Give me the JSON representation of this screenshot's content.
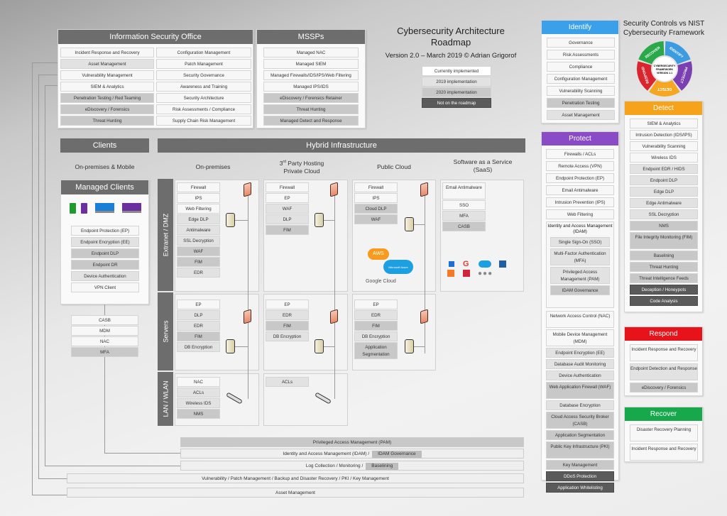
{
  "title": {
    "line1": "Cybersecurity Architecture",
    "line2": "Roadmap",
    "version": "Version 2.0 – March 2019 ©  Adrian Grigorof"
  },
  "legend": [
    {
      "label": "Currently implemented",
      "status": "current"
    },
    {
      "label": "2019 implementation",
      "status": "2019"
    },
    {
      "label": "2020 implementation",
      "status": "2020"
    },
    {
      "label": "Not on the roadmap",
      "status": "none"
    }
  ],
  "iso": {
    "title": "Information Security Office",
    "left": [
      {
        "label": "Incident Response and Recovery",
        "s": 0
      },
      {
        "label": "Asset Management",
        "s": 1
      },
      {
        "label": "Vulnerability Management",
        "s": 0
      },
      {
        "label": "SIEM & Analytics",
        "s": 0
      },
      {
        "label": "Penetration Testing / Red Teaming",
        "s": 2
      },
      {
        "label": "eDiscovery / Forensics",
        "s": 2
      },
      {
        "label": "Threat Hunting",
        "s": 2
      }
    ],
    "right": [
      {
        "label": "Configuration Management",
        "s": 0
      },
      {
        "label": "Patch Management",
        "s": 0
      },
      {
        "label": "Security Governance",
        "s": 0
      },
      {
        "label": "Awareness and Training",
        "s": 0
      },
      {
        "label": "Security Architecture",
        "s": 0
      },
      {
        "label": "Risk Assessments / Compliance",
        "s": 0
      },
      {
        "label": "Supply Chain Risk Management",
        "s": 0
      }
    ]
  },
  "mssp": {
    "title": "MSSPs",
    "items": [
      {
        "label": "Managed NAC",
        "s": 0
      },
      {
        "label": "Managed SIEM",
        "s": 0
      },
      {
        "label": "Managed Firewalls/IDS/IPS/Web Filtering",
        "s": 0
      },
      {
        "label": "Managed IPS/IDS",
        "s": 0
      },
      {
        "label": "eDiscovery / Forensics Retainer",
        "s": 2
      },
      {
        "label": "Threat Hunting",
        "s": 2
      },
      {
        "label": "Managed Detect and Response",
        "s": 2
      }
    ]
  },
  "clients": {
    "title": "Clients",
    "subtitle": "On-premises & Mobile",
    "managed_title": "Managed Clients",
    "devices": [
      "android-phone",
      "apple-phone",
      "windows-desktop",
      "apple-desktop"
    ],
    "items": [
      {
        "label": "Endpoint Protection (EP)",
        "s": 0
      },
      {
        "label": "Endpoint Encryption (EE)",
        "s": 1
      },
      {
        "label": "Endpoint DLP",
        "s": 2
      },
      {
        "label": "Endpoint DR",
        "s": 2
      },
      {
        "label": "Device Authentication",
        "s": 1
      },
      {
        "label": "VPN Client",
        "s": 0
      }
    ],
    "extra": [
      {
        "label": "CASB",
        "s": 0
      },
      {
        "label": "MDM",
        "s": 0
      },
      {
        "label": "NAC",
        "s": 0
      },
      {
        "label": "MFA",
        "s": 2
      }
    ]
  },
  "hybrid": {
    "title": "Hybrid Infrastructure",
    "columns": [
      "On-premises",
      "3rd Party Hosting Private Cloud",
      "Public Cloud",
      "Software as a Service (SaaS)"
    ],
    "zones": [
      "Extranet / DMZ",
      "Servers",
      "LAN / WLAN"
    ],
    "onprem_dmz": [
      {
        "label": "Firewall",
        "s": 0
      },
      {
        "label": "IPS",
        "s": 0
      },
      {
        "label": "Web Filtering",
        "s": 0
      },
      {
        "label": "Edge DLP",
        "s": 1
      },
      {
        "label": "Antimalware",
        "s": 1
      },
      {
        "label": "SSL Decryption",
        "s": 1
      },
      {
        "label": "WAF",
        "s": 2
      },
      {
        "label": "FIM",
        "s": 2
      },
      {
        "label": "EDR",
        "s": 1
      }
    ],
    "hosting_dmz": [
      {
        "label": "Firewall",
        "s": 0
      },
      {
        "label": "EP",
        "s": 0
      },
      {
        "label": "WAF",
        "s": 1
      },
      {
        "label": "DLP",
        "s": 1
      },
      {
        "label": "FIM",
        "s": 2
      }
    ],
    "public_dmz": [
      {
        "label": "Firewall",
        "s": 0
      },
      {
        "label": "IPS",
        "s": 0
      },
      {
        "label": "Cloud DLP",
        "s": 2
      },
      {
        "label": "WAF",
        "s": 2
      }
    ],
    "saas": [
      {
        "label": "Email Antimalware",
        "s": 0
      },
      {
        "label": "SSO",
        "s": 0
      },
      {
        "label": "MFA",
        "s": 1
      },
      {
        "label": "CASB",
        "s": 2
      }
    ],
    "cloud_logos": [
      "AWS",
      "Microsoft Azure",
      "Google Cloud"
    ],
    "saas_logos": [
      "dropbox",
      "google",
      "salesforce",
      "box",
      "office",
      "other",
      "more"
    ],
    "onprem_srv": [
      {
        "label": "EP",
        "s": 0
      },
      {
        "label": "DLP",
        "s": 1
      },
      {
        "label": "EDR",
        "s": 1
      },
      {
        "label": "FIM",
        "s": 2
      },
      {
        "label": "DB Encryption",
        "s": 1
      }
    ],
    "hosting_srv": [
      {
        "label": "EP",
        "s": 0
      },
      {
        "label": "EDR",
        "s": 1
      },
      {
        "label": "FIM",
        "s": 2
      },
      {
        "label": "DB Encryption",
        "s": 1
      }
    ],
    "public_srv": [
      {
        "label": "EP",
        "s": 0
      },
      {
        "label": "EDR",
        "s": 1
      },
      {
        "label": "FIM",
        "s": 2
      },
      {
        "label": "DB Encryption",
        "s": 1
      },
      {
        "label": "Application Segmentation",
        "s": 2
      }
    ],
    "onprem_lan": [
      {
        "label": "NAC",
        "s": 0
      },
      {
        "label": "ACLs",
        "s": 1
      },
      {
        "label": "Wireless IDS",
        "s": 1
      },
      {
        "label": "NMS",
        "s": 2
      }
    ],
    "hosting_lan": [
      {
        "label": "ACLs",
        "s": 1
      }
    ]
  },
  "bars": {
    "pam": "Privileged Access Management (PAM)",
    "idam": "Identity and Access Management (IDAM) /",
    "idam_inline": "IDAM Governance",
    "log": "Log Collection / Monitoring /",
    "log_inline": "Baselining",
    "vuln": "Vulnerability / Patch Management / Backup and Disaster Recovery / PKI / Key Management",
    "asset": "Asset Management"
  },
  "nist": {
    "title": "Security Controls vs NIST Cybersecurity Framework",
    "wheel_center": "CYBERSECURITY FRAMEWORK VERSION 1.1",
    "wheel": [
      {
        "label": "IDENTIFY",
        "color": "#3d9ce0"
      },
      {
        "label": "PROTECT",
        "color": "#7a3fb0"
      },
      {
        "label": "DETECT",
        "color": "#f5a623"
      },
      {
        "label": "RESPOND",
        "color": "#d9262e"
      },
      {
        "label": "RECOVER",
        "color": "#2aa84a"
      }
    ],
    "identify": {
      "title": "Identify",
      "color": "#3aa0ea",
      "items": [
        {
          "label": "Governance",
          "s": 0
        },
        {
          "label": "Risk Assessments",
          "s": 0
        },
        {
          "label": "Compliance",
          "s": 0
        },
        {
          "label": "Configuration Management",
          "s": 0
        },
        {
          "label": "Vulnerability Scanning",
          "s": 0
        },
        {
          "label": "Penetration Testing",
          "s": 2
        },
        {
          "label": "Asset Management",
          "s": 1
        }
      ]
    },
    "protect": {
      "title": "Protect",
      "color": "#8a4bc6",
      "items": [
        {
          "label": "Firewalls / ACLs",
          "s": 0
        },
        {
          "label": "Remote Access (VPN)",
          "s": 0
        },
        {
          "label": "Endpoint Protection (EP)",
          "s": 0
        },
        {
          "label": "Email Antimalware",
          "s": 0
        },
        {
          "label": "Intrusion Prevention (IPS)",
          "s": 0
        },
        {
          "label": "Web Filtering",
          "s": 0
        }
      ],
      "idam": {
        "label": "Identity and Access Management (IDAM)",
        "items": [
          {
            "label": "Single Sign-On (SSO)",
            "s": 1
          },
          {
            "label": "Multi-Factor Authentication (MFA)",
            "s": 1
          },
          {
            "label": "Privileged Access Management (PAM)",
            "s": 1
          },
          {
            "label": "IDAM Governance",
            "s": 2
          }
        ]
      },
      "items2": [
        {
          "label": "Network Access Control (NAC)",
          "s": 0,
          "t": 1
        },
        {
          "label": "Mobile Device Management (MDM)",
          "s": 0,
          "t": 1
        },
        {
          "label": "Endpoint Encryption (EE)",
          "s": 1
        },
        {
          "label": "Database Audit Monitoring",
          "s": 1
        },
        {
          "label": "Device Authentication",
          "s": 1
        },
        {
          "label": "Web Application Firewall (WAF)",
          "s": 2,
          "t": 1
        },
        {
          "label": "Database Encryption",
          "s": 1
        },
        {
          "label": "Cloud Access Security Broker (CASB)",
          "s": 2,
          "t": 1
        },
        {
          "label": "Application Segmentation",
          "s": 2
        },
        {
          "label": "Public Key Infrastructure (PKI)",
          "s": 2,
          "t": 1
        },
        {
          "label": "Key Management",
          "s": 2
        },
        {
          "label": "DDoS Protection",
          "s": 3
        },
        {
          "label": "Application Whitelisting",
          "s": 3
        }
      ]
    },
    "detect": {
      "title": "Detect",
      "color": "#f7a21b",
      "items": [
        {
          "label": "SIEM & Analytics",
          "s": 0
        },
        {
          "label": "Intrusion Detection (IDS/IPS)",
          "s": 0
        },
        {
          "label": "Vulnerability Scanning",
          "s": 0
        },
        {
          "label": "Wireless IDS",
          "s": 0
        },
        {
          "label": "Endpoint EDR / HIDS",
          "s": 1
        },
        {
          "label": "Endpoint DLP",
          "s": 1
        },
        {
          "label": "Edge DLP",
          "s": 1
        },
        {
          "label": "Edge Antimalware",
          "s": 1
        },
        {
          "label": "SSL Decryption",
          "s": 1
        },
        {
          "label": "NMS",
          "s": 2
        },
        {
          "label": "File Integrity Monitoring (FIM)",
          "s": 2,
          "t": 1
        },
        {
          "label": "Baselining",
          "s": 2
        },
        {
          "label": "Threat Hunting",
          "s": 2
        },
        {
          "label": "Threat Intelligence Feeds",
          "s": 2
        },
        {
          "label": "Deception / Honeypots",
          "s": 3
        },
        {
          "label": "Code Analysis",
          "s": 3
        }
      ]
    },
    "respond": {
      "title": "Respond",
      "color": "#e8121a",
      "items": [
        {
          "label": "Incident Response and Recovery",
          "s": 0,
          "t": 1
        },
        {
          "label": "Endpoint Detection and Response",
          "s": 1,
          "t": 1
        },
        {
          "label": "eDiscovery / Forensics",
          "s": 2
        }
      ]
    },
    "recover": {
      "title": "Recover",
      "color": "#17a84b",
      "items": [
        {
          "label": "Disaster Recovery Planning",
          "s": 0,
          "t": 1
        },
        {
          "label": "Incident Response and Recovery",
          "s": 0,
          "t": 1
        }
      ]
    }
  }
}
